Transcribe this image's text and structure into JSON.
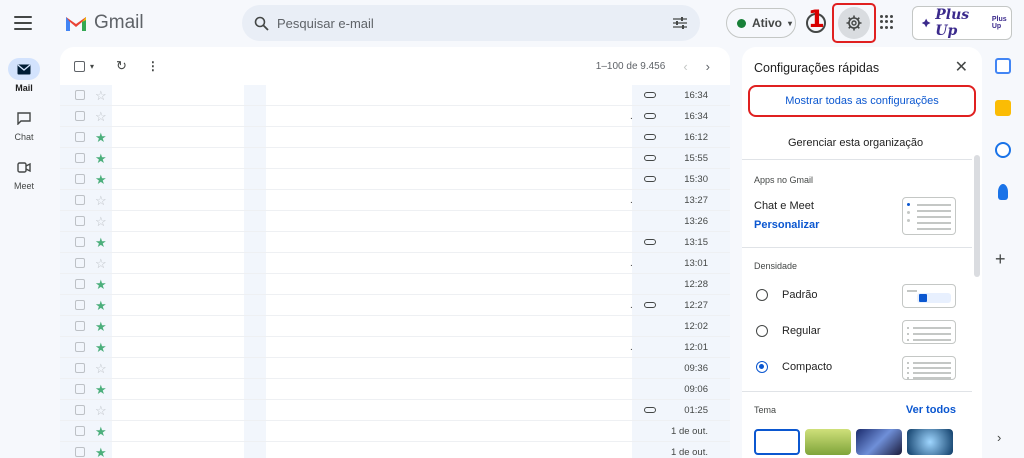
{
  "app": {
    "name": "Gmail"
  },
  "nav": {
    "items": [
      {
        "label": "Mail",
        "icon": "mail-icon",
        "active": true
      },
      {
        "label": "Chat",
        "icon": "chat-icon",
        "active": false
      },
      {
        "label": "Meet",
        "icon": "meet-icon",
        "active": false
      }
    ]
  },
  "search": {
    "placeholder": "Pesquisar e-mail"
  },
  "status": {
    "label": "Ativo",
    "color": "#188038"
  },
  "brand": {
    "text": "Plus Up",
    "small": "Plus Up"
  },
  "annotations": {
    "one": "1",
    "two": "2"
  },
  "list": {
    "pagination": "1–100 de 9.456",
    "rows": [
      {
        "starred": false,
        "clip": true,
        "dot": false,
        "time": "16:34"
      },
      {
        "starred": false,
        "clip": true,
        "dot": true,
        "time": "16:34"
      },
      {
        "starred": true,
        "clip": true,
        "dot": false,
        "time": "16:12"
      },
      {
        "starred": true,
        "clip": true,
        "dot": false,
        "time": "15:55"
      },
      {
        "starred": true,
        "clip": true,
        "dot": false,
        "time": "15:30"
      },
      {
        "starred": false,
        "clip": false,
        "dot": true,
        "time": "13:27"
      },
      {
        "starred": false,
        "clip": false,
        "dot": false,
        "time": "13:26"
      },
      {
        "starred": true,
        "clip": true,
        "dot": false,
        "time": "13:15"
      },
      {
        "starred": false,
        "clip": false,
        "dot": true,
        "time": "13:01"
      },
      {
        "starred": true,
        "clip": false,
        "dot": false,
        "time": "12:28"
      },
      {
        "starred": true,
        "clip": true,
        "dot": true,
        "time": "12:27"
      },
      {
        "starred": true,
        "clip": false,
        "dot": false,
        "time": "12:02"
      },
      {
        "starred": true,
        "clip": false,
        "dot": true,
        "time": "12:01"
      },
      {
        "starred": false,
        "clip": false,
        "dot": false,
        "time": "09:36"
      },
      {
        "starred": true,
        "clip": false,
        "dot": false,
        "time": "09:06"
      },
      {
        "starred": false,
        "clip": true,
        "dot": false,
        "time": "01:25"
      },
      {
        "starred": true,
        "clip": false,
        "dot": false,
        "time": "1 de out."
      },
      {
        "starred": true,
        "clip": false,
        "dot": false,
        "time": "1 de out."
      }
    ]
  },
  "settings": {
    "title": "Configurações rápidas",
    "show_all": "Mostrar todas as configurações",
    "manage": "Gerenciar esta organização",
    "apps_section": "Apps no Gmail",
    "chat_meet": "Chat e Meet",
    "customize": "Personalizar",
    "density_section": "Densidade",
    "density": [
      {
        "label": "Padrão",
        "selected": false
      },
      {
        "label": "Regular",
        "selected": false
      },
      {
        "label": "Compacto",
        "selected": true
      }
    ],
    "theme_section": "Tema",
    "see_all": "Ver todos"
  },
  "colors": {
    "accent": "#0b57d0",
    "highlight": "#e02020",
    "star": "#4caf7c"
  }
}
